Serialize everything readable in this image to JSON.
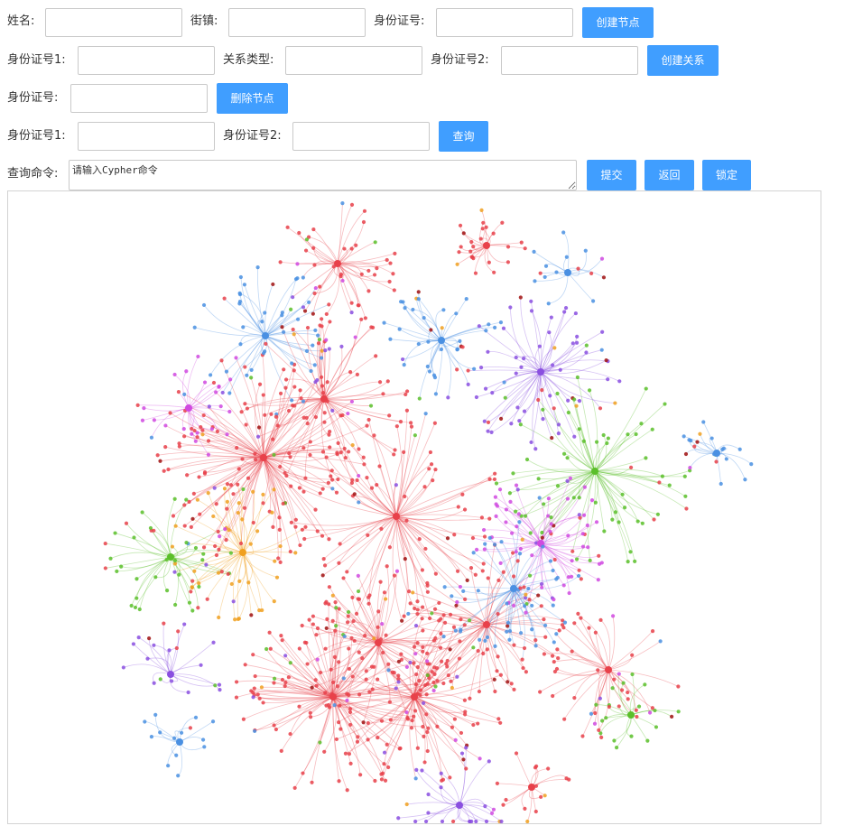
{
  "create_node": {
    "name_label": "姓名:",
    "town_label": "街镇:",
    "id_label": "身份证号:",
    "name_value": "",
    "town_value": "",
    "id_value": "",
    "button": "创建节点"
  },
  "create_relation": {
    "id1_label": "身份证号1:",
    "type_label": "关系类型:",
    "id2_label": "身份证号2:",
    "id1_value": "",
    "type_value": "",
    "id2_value": "",
    "button": "创建关系"
  },
  "delete_node": {
    "id_label": "身份证号:",
    "id_value": "",
    "button": "删除节点"
  },
  "query": {
    "id1_label": "身份证号1:",
    "id2_label": "身份证号2:",
    "id1_value": "",
    "id2_value": "",
    "button": "查询"
  },
  "cypher": {
    "label": "查询命令:",
    "placeholder": "请输入Cypher命令",
    "value": "",
    "submit_button": "提交",
    "back_button": "返回",
    "lock_button": "锁定"
  },
  "graph": {
    "colors": {
      "red": "#e8414a",
      "blue": "#4a90e2",
      "purple": "#8a4fe0",
      "green": "#5bbf2a",
      "orange": "#f0a020",
      "magenta": "#d04ae0",
      "darkred": "#a01010"
    }
  }
}
